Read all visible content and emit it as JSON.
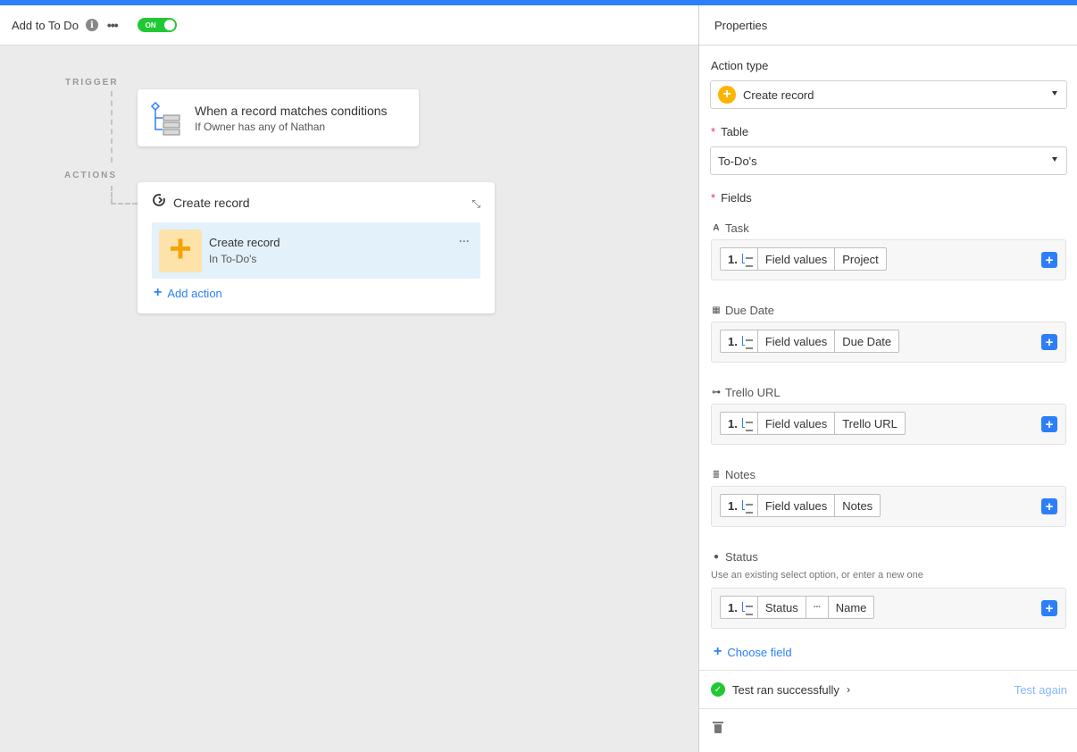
{
  "colors": {
    "accent": "#2d7ff9",
    "toggle_on": "#20c933",
    "required": "#ef3061"
  },
  "header": {
    "automation_name": "Add to To Do",
    "info_icon": "info-icon",
    "more_icon": "more-icon",
    "toggle_label": "ON"
  },
  "canvas": {
    "trigger_label": "TRIGGER",
    "actions_label": "ACTIONS",
    "trigger_card": {
      "title": "When a record matches conditions",
      "subtitle": "If Owner has any of Nathan"
    },
    "action_card": {
      "title": "Create record",
      "item_title": "Create record",
      "item_subtitle": "In To-Do's",
      "add_action": "Add action"
    }
  },
  "panel": {
    "title": "Properties",
    "action_type_label": "Action type",
    "action_type_value": "Create record",
    "table_label": "Table",
    "table_value": "To-Do's",
    "fields_label": "Fields",
    "fields": [
      {
        "name": "Task",
        "icon": "text-icon",
        "icon_glyph": "A",
        "tokens": [
          "1.",
          "Field values",
          "Project"
        ]
      },
      {
        "name": "Due Date",
        "icon": "calendar-icon",
        "icon_glyph": "▦",
        "tokens": [
          "1.",
          "Field values",
          "Due Date"
        ]
      },
      {
        "name": "Trello URL",
        "icon": "link-icon",
        "icon_glyph": "⊶",
        "tokens": [
          "1.",
          "Field values",
          "Trello URL"
        ]
      },
      {
        "name": "Notes",
        "icon": "long-text-icon",
        "icon_glyph": "≣",
        "tokens": [
          "1.",
          "Field values",
          "Notes"
        ]
      },
      {
        "name": "Status",
        "icon": "single-select-icon",
        "icon_glyph": "●",
        "hint": "Use an existing select option, or enter a new one",
        "tokens": [
          "1.",
          "Status",
          "···",
          "Name"
        ]
      }
    ],
    "choose_field": "Choose field",
    "test_status": "Test ran successfully",
    "test_again": "Test again"
  }
}
